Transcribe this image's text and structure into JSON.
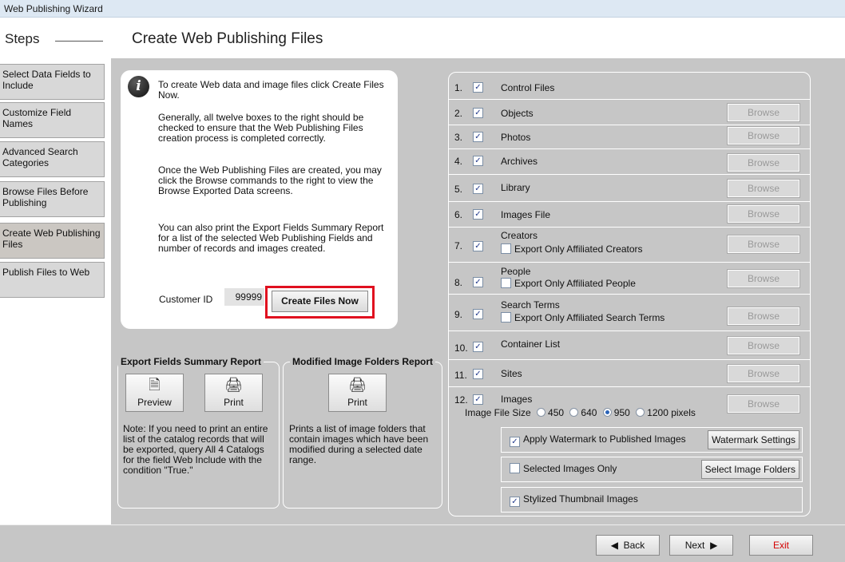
{
  "window": {
    "title": "Web Publishing Wizard"
  },
  "steps": {
    "header": "Steps",
    "items": [
      {
        "label": "Select Data Fields to Include"
      },
      {
        "label": "Customize Field Names"
      },
      {
        "label": "Advanced Search Categories"
      },
      {
        "label": "Browse Files Before Publishing"
      },
      {
        "label": "Create Web Publishing Files"
      },
      {
        "label": "Publish Files to Web"
      }
    ]
  },
  "page": {
    "title": "Create Web Publishing Files"
  },
  "info": {
    "icon": "info-icon",
    "p1": "To create Web data and image files click Create Files Now.",
    "p2": "Generally, all twelve boxes to the right should be checked to ensure that the Web Publishing Files creation process is completed correctly.",
    "p3": "Once the Web Publishing Files are created, you may click the Browse commands to the right to view the Browse Exported Data screens.",
    "p4": "You can also print the Export Fields Summary Report for a list of the selected Web Publishing Fields and number of records and images created.",
    "customer_id_label": "Customer ID",
    "customer_id_value": "99999",
    "create_button": "Create Files Now"
  },
  "export_report": {
    "title": "Export Fields Summary Report",
    "preview_label": "Preview",
    "print_label": "Print",
    "note": "Note: If you need to print an entire list of the catalog records that will be exported, query All 4 Catalogs for the field Web Include with the condition \"True.\""
  },
  "image_report": {
    "title": "Modified Image Folders Report",
    "print_label": "Print",
    "note": "Prints a list of image folders that contain images which have been modified during a selected date range."
  },
  "files": {
    "browse_label": "Browse",
    "check_mark": "✓",
    "rows": [
      {
        "num": "1.",
        "label": "Control Files"
      },
      {
        "num": "2.",
        "label": "Objects"
      },
      {
        "num": "3.",
        "label": "Photos"
      },
      {
        "num": "4.",
        "label": "Archives"
      },
      {
        "num": "5.",
        "label": "Library"
      },
      {
        "num": "6.",
        "label": "Images File"
      },
      {
        "num": "7.",
        "label": "Creators",
        "sub": "Export Only Affiliated Creators"
      },
      {
        "num": "8.",
        "label": "People",
        "sub": "Export Only Affiliated People"
      },
      {
        "num": "9.",
        "label": "Search Terms",
        "sub": "Export Only Affiliated Search Terms"
      },
      {
        "num": "10.",
        "label": "Container List"
      },
      {
        "num": "11.",
        "label": "Sites"
      },
      {
        "num": "12.",
        "label": "Images"
      }
    ],
    "image_size_label": "Image File Size",
    "sizes": [
      "450",
      "640",
      "950",
      "1200"
    ],
    "selected_size": "950",
    "size_unit": "pixels",
    "watermark_label": "Apply Watermark to Published Images",
    "watermark_button": "Watermark Settings",
    "selected_only_label": "Selected Images Only",
    "select_folders_button": "Select Image Folders",
    "thumbnail_label": "Stylized Thumbnail Images"
  },
  "footer": {
    "back": "Back",
    "next": "Next",
    "exit": "Exit",
    "exit_color": "#d40000"
  }
}
